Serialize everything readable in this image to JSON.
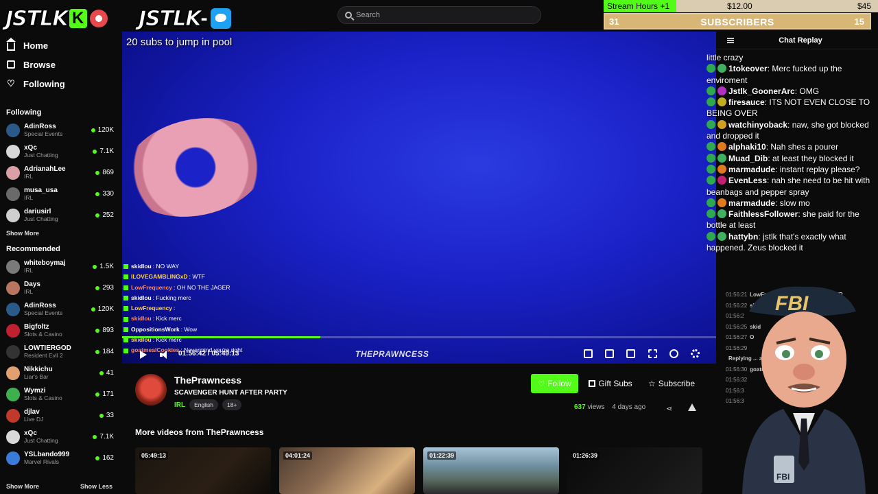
{
  "header": {
    "logo_left": "JSTLK",
    "logo_left_k": "K",
    "logo_right": "JSTLK",
    "logo_right_dash": "-",
    "search_placeholder": "Search"
  },
  "overlay": {
    "stream_hours": "Stream Hours +1",
    "goal_current": "$12.00",
    "goal_target": "$45",
    "subs_current": "31",
    "subs_label": "SUBSCRIBERS",
    "subs_target": "15"
  },
  "sidebar": {
    "nav": [
      {
        "label": "Home",
        "icon": "home-icon"
      },
      {
        "label": "Browse",
        "icon": "browse-icon"
      },
      {
        "label": "Following",
        "icon": "heart-icon"
      }
    ],
    "following_title": "Following",
    "following": [
      {
        "name": "AdinRoss",
        "category": "Special Events",
        "viewers": "120K",
        "color": "#2b5a8a"
      },
      {
        "name": "xQc",
        "category": "Just Chatting",
        "viewers": "7.1K",
        "color": "#d8d8d8"
      },
      {
        "name": "AdrianahLee",
        "category": "IRL",
        "viewers": "869",
        "color": "#d9a0a8"
      },
      {
        "name": "musa_usa",
        "category": "IRL",
        "viewers": "330",
        "color": "#6a6a6a"
      },
      {
        "name": "dariusirl",
        "category": "Just Chatting",
        "viewers": "252",
        "color": "#cfcfcf"
      }
    ],
    "show_more": "Show More",
    "recommended_title": "Recommended",
    "recommended": [
      {
        "name": "whiteboymaj",
        "category": "IRL",
        "viewers": "1.5K",
        "color": "#7a7a7a"
      },
      {
        "name": "Days",
        "category": "IRL",
        "viewers": "293",
        "color": "#b87560"
      },
      {
        "name": "AdinRoss",
        "category": "Special Events",
        "viewers": "120K",
        "color": "#2b5a8a"
      },
      {
        "name": "Bigfoltz",
        "category": "Slots & Casino",
        "viewers": "893",
        "color": "#c02030"
      },
      {
        "name": "LOWTIERGOD",
        "category": "Resident Evil 2",
        "viewers": "184",
        "color": "#333"
      },
      {
        "name": "Nikkichu",
        "category": "Liar's Bar",
        "viewers": "41",
        "color": "#e0a070"
      },
      {
        "name": "Wymzi",
        "category": "Slots & Casino",
        "viewers": "171",
        "color": "#3fb050"
      },
      {
        "name": "djlav",
        "category": "Live DJ",
        "viewers": "33",
        "color": "#c0392b"
      },
      {
        "name": "xQc",
        "category": "Just Chatting",
        "viewers": "7.1K",
        "color": "#d8d8d8"
      },
      {
        "name": "YSLbando999",
        "category": "Marvel Rivals",
        "viewers": "162",
        "color": "#3a7ad8"
      }
    ],
    "show_more_bottom": "Show More",
    "show_less": "Show Less"
  },
  "video": {
    "caption": "20 subs to jump in pool",
    "overlay_chat": [
      {
        "name": "skidlou",
        "msg": ": NO WAY"
      },
      {
        "name": "ILOVEGAMBLINGxD",
        "msg": ": WTF"
      },
      {
        "name": "LowFrequency",
        "msg": ": OH NO THE JAGER"
      },
      {
        "name": "skidlou",
        "msg": ": Fucking merc"
      },
      {
        "name": "LowFrequency",
        "msg": ":"
      },
      {
        "name": "skidlou",
        "msg": ": Kick merc"
      },
      {
        "name": "OppositionsWork",
        "msg": ": Wow"
      },
      {
        "name": "skidlou",
        "msg": ": Kick merc"
      },
      {
        "name": "goatmealCookies",
        "msg": ": Nevermind you're right"
      }
    ],
    "time": "01:56:42 / 05:49:13",
    "progress": 0.334,
    "brand": "THEPRAWNCESS",
    "controls": [
      "pip-icon",
      "theater-icon",
      "miniplayer-icon",
      "fullscreen-icon",
      "speed-icon",
      "settings-icon"
    ]
  },
  "channel": {
    "name": "ThePrawncess",
    "title": "SCAVENGER HUNT AFTER PARTY",
    "category": "IRL",
    "tags": [
      "English",
      "18+"
    ],
    "follow_label": "Follow",
    "gift_label": "Gift Subs",
    "subscribe_label": "Subscribe",
    "views_count": "637",
    "views_label": "views",
    "age": "4 days ago",
    "more_title": "More videos from ThePrawncess",
    "thumbs": [
      {
        "duration": "05:49:13",
        "bg": "linear-gradient(135deg,#1a1510,#2b1f14 60%,#0d0b09)"
      },
      {
        "duration": "04:01:24",
        "bg": "linear-gradient(135deg,#4a3a30,#8a6a50 40%,#d8b080 75%,#6a4a30)"
      },
      {
        "duration": "01:22:39",
        "bg": "linear-gradient(180deg,#a8c4d8 0%,#6f8fa0 40%,#5a6a60 70%,#2a2a2a)"
      },
      {
        "duration": "01:26:39",
        "bg": "linear-gradient(135deg,#0a0a0a,#151515 60%,#1e1e1e)"
      }
    ]
  },
  "chat": {
    "title": "Chat Replay",
    "big_lines": [
      {
        "name": "",
        "msg": "little crazy",
        "icon": ""
      },
      {
        "name": "1tokeover",
        "msg": ": Merc fucked up the enviroment",
        "icon": "#3fb060"
      },
      {
        "name": "Jstlk_GoonerArc",
        "msg": ": OMG",
        "icon": "#b030c0"
      },
      {
        "name": "firesauce",
        "msg": ": ITS NOT EVEN CLOSE TO BEING OVER",
        "icon": "#c0b020"
      },
      {
        "name": "watchinyoback",
        "msg": ": naw, she got blocked and dropped it",
        "icon": "#d0a020"
      },
      {
        "name": "alphaki10",
        "msg": ": Nah shes a pourer",
        "icon": "#e07a20"
      },
      {
        "name": "Muad_Dib",
        "msg": ": at least they blocked it",
        "icon": "#3fb060"
      },
      {
        "name": "marmadude",
        "msg": ": instant replay please?",
        "icon": "#e07a20"
      },
      {
        "name": "EvenLess",
        "msg": ": nah she need to be hit with beanbags and pepper spray",
        "icon": "#c02070"
      },
      {
        "name": "marmadude",
        "msg": ": slow mo",
        "icon": "#e07a20"
      },
      {
        "name": "FaithlessFollower",
        "msg": ": she paid for the bottle at least",
        "icon": "#3fb060"
      },
      {
        "name": "hattybn",
        "msg": ": jstlk that's exactly what happened. Zeus blocked it",
        "icon": "#3fb060"
      }
    ],
    "replay_lines": [
      {
        "time": "01:56:21",
        "text": "LowFrequency: OH NO THE JAGER"
      },
      {
        "time": "01:56:22",
        "text": "skidlou"
      },
      {
        "time": "01:56:2",
        "text": ""
      },
      {
        "time": "01:56:25",
        "text": "skid"
      },
      {
        "time": "01:56:27",
        "text": "O"
      },
      {
        "time": "01:56:29",
        "text": ""
      },
      {
        "time": "",
        "text": "Replying ... aybe rewind"
      },
      {
        "time": "01:56:30",
        "text": "goatmealCookies: ... ind you're right"
      },
      {
        "time": "01:56:32",
        "text": ""
      },
      {
        "time": "01:56:3",
        "text": ""
      },
      {
        "time": "01:56:3",
        "text": ""
      }
    ],
    "mascot_text": "FBI",
    "badge_text": "FBI"
  },
  "colors": {
    "accent": "#53fc18",
    "bg": "#0b0b0c"
  }
}
